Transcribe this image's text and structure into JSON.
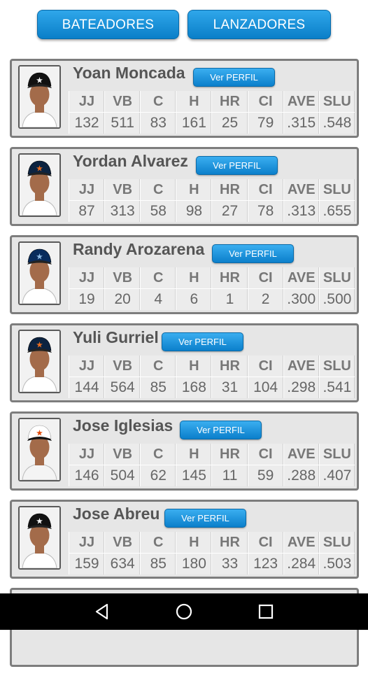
{
  "tabs": {
    "batters": "BATEADORES",
    "pitchers": "LANZADORES"
  },
  "profile_button_label": "Ver PERFIL",
  "stat_headers": [
    "JJ",
    "VB",
    "C",
    "H",
    "HR",
    "CI",
    "AVE",
    "SLU"
  ],
  "players": [
    {
      "name": "Yoan Moncada",
      "cap": "white-sox-cap-icon",
      "cap_color": "#111111",
      "logo_color": "#ffffff",
      "stats": [
        "132",
        "511",
        "83",
        "161",
        "25",
        "79",
        ".315",
        ".548"
      ]
    },
    {
      "name": "Yordan Alvarez",
      "cap": "astros-cap-icon",
      "cap_color": "#0c2340",
      "logo_color": "#eb6e1f",
      "stats": [
        "87",
        "313",
        "58",
        "98",
        "27",
        "78",
        ".313",
        ".655"
      ]
    },
    {
      "name": "Randy Arozarena",
      "cap": "rays-cap-icon",
      "cap_color": "#092c5c",
      "logo_color": "#8fbce6",
      "stats": [
        "19",
        "20",
        "4",
        "6",
        "1",
        "2",
        ".300",
        ".500"
      ]
    },
    {
      "name": "Yuli Gurriel",
      "cap": "astros-cap-icon",
      "cap_color": "#0c2340",
      "logo_color": "#eb6e1f",
      "stats": [
        "144",
        "564",
        "85",
        "168",
        "31",
        "104",
        ".298",
        ".541"
      ]
    },
    {
      "name": "Jose Iglesias",
      "cap": "orioles-cap-icon",
      "cap_color": "#ffffff",
      "logo_color": "#df4601",
      "stats": [
        "146",
        "504",
        "62",
        "145",
        "11",
        "59",
        ".288",
        ".407"
      ]
    },
    {
      "name": "Jose Abreu",
      "cap": "white-sox-cap-icon",
      "cap_color": "#111111",
      "logo_color": "#ffffff",
      "stats": [
        "159",
        "634",
        "85",
        "180",
        "33",
        "123",
        ".284",
        ".503"
      ]
    }
  ],
  "nav": {
    "back": "back-icon",
    "home": "home-icon",
    "recent": "recent-apps-icon"
  }
}
